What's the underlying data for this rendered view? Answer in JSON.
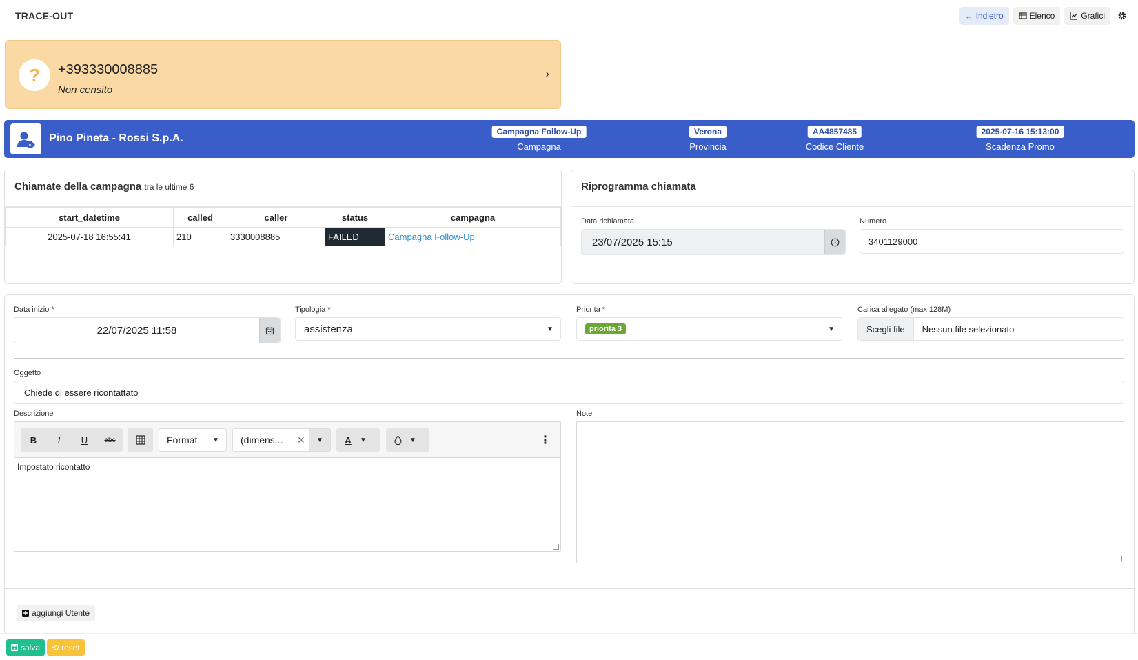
{
  "app": {
    "title": "TRACE-OUT"
  },
  "toolbar": {
    "back_label": "Indietro",
    "list_label": "Elenco",
    "charts_label": "Grafici"
  },
  "caller": {
    "number": "+393330008885",
    "status": "Non censito"
  },
  "customer": {
    "name": "Pino Pineta - Rossi S.p.A.",
    "fields": [
      {
        "value": "Campagna Follow-Up",
        "label": "Campagna"
      },
      {
        "value": "Verona",
        "label": "Provincia"
      },
      {
        "value": "AA4857485",
        "label": "Codice Cliente"
      },
      {
        "value": "2025-07-16 15:13:00",
        "label": "Scadenza Promo"
      }
    ]
  },
  "calls_panel": {
    "title": "Chiamate della campagna",
    "subtitle": "tra le ultime 6",
    "columns": [
      "start_datetime",
      "called",
      "caller",
      "status",
      "campagna"
    ],
    "rows": [
      {
        "start_datetime": "2025-07-18 16:55:41",
        "called": "210",
        "caller": "3330008885",
        "status": "FAILED",
        "campagna": "Campagna Follow-Up"
      }
    ]
  },
  "reschedule": {
    "title": "Riprogramma chiamata",
    "date_label": "Data richiamata",
    "date_value": "23/07/2025 15:15",
    "number_label": "Numero",
    "number_value": "3401129000"
  },
  "form": {
    "start_label": "Data inizio *",
    "start_value": "22/07/2025 11:58",
    "type_label": "Tipologia *",
    "type_value": "assistenza",
    "priority_label": "Priorita *",
    "priority_value": "priorita 3",
    "attach_label": "Carica allegato (max 128M)",
    "attach_button": "Scegli file",
    "attach_status": "Nessun file selezionato",
    "subject_label": "Oggetto",
    "subject_value": "Chiede di essere ricontattato",
    "description_label": "Descrizione",
    "description_value": "Impostato ricontatto",
    "notes_label": "Note",
    "notes_value": ""
  },
  "editor": {
    "format_label": "Format",
    "size_label": "(dimens...",
    "bold": "B",
    "italic": "I",
    "underline": "U",
    "strike": "abc",
    "font_color": "A"
  },
  "actions": {
    "add_user": "aggiungi Utente",
    "save": "salva",
    "reset": "reset"
  },
  "colors": {
    "accent_blue": "#3a5ec9",
    "caller_bg": "#fad9a4",
    "save_green": "#1fbf8f",
    "reset_yellow": "#f8c33a",
    "priority_green": "#6aa733"
  }
}
